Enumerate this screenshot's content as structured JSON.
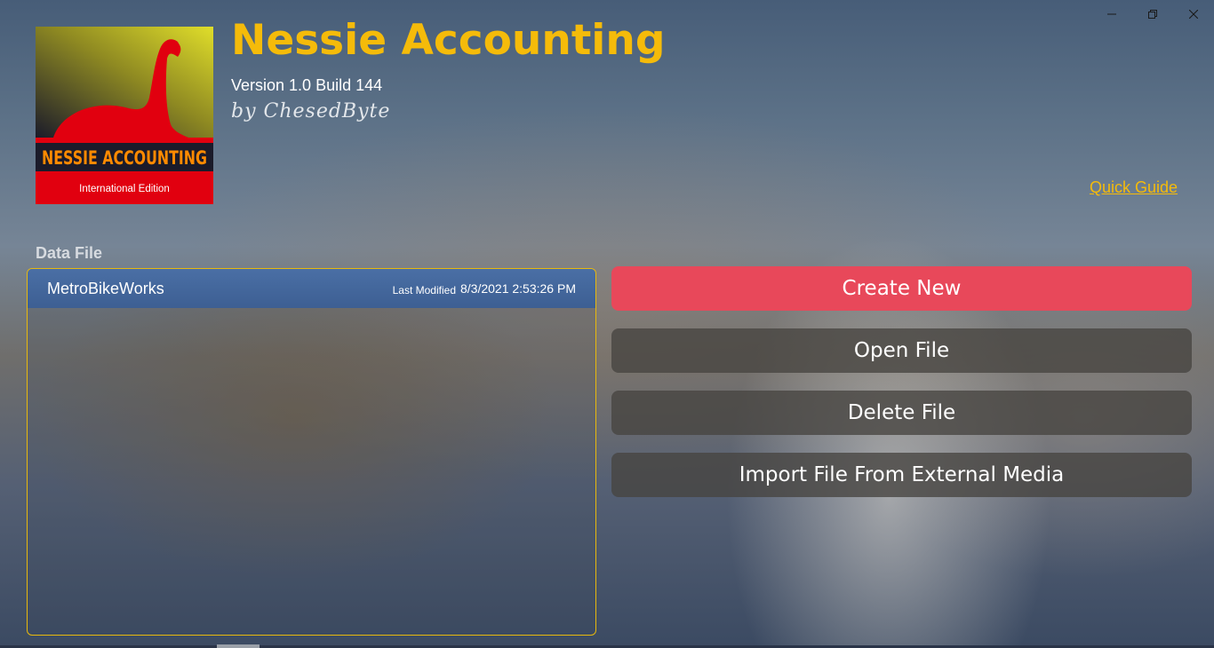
{
  "window_controls": {
    "minimize_icon": "minimize-icon",
    "restore_icon": "restore-icon",
    "close_icon": "close-icon"
  },
  "logo": {
    "title": "NESSIE ACCOUNTING",
    "subtitle": "International Edition",
    "colors": {
      "red": "#e1000f",
      "yellow": "#e0de2a",
      "orange": "#ff8a00",
      "dark": "#1b1b2a"
    }
  },
  "header": {
    "title": "Nessie Accounting",
    "version": "Version 1.0 Build 144",
    "author": "by ChesedByte"
  },
  "quick_guide": "Quick Guide",
  "data_file": {
    "section_label": "Data File",
    "files": [
      {
        "name": "MetroBikeWorks",
        "last_modified_label": "Last Modified",
        "last_modified": "8/3/2021 2:53:26 PM"
      }
    ]
  },
  "actions": {
    "create_new": "Create New",
    "open_file": "Open File",
    "delete_file": "Delete File",
    "import_file": "Import File From External Media"
  },
  "colors": {
    "accent": "#f5bb0a",
    "primary_button": "#e8485a",
    "selected_row": "#4a6fa5"
  }
}
